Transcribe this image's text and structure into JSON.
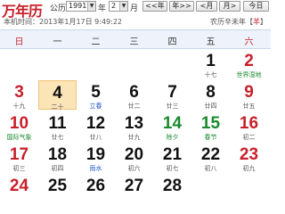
{
  "toolbar": {
    "title": "万年历",
    "calendar_type_label": "公历",
    "year_value": "1991",
    "year_unit": "年",
    "month_value": "2",
    "month_unit": "月",
    "prev_year_label": "<<年",
    "next_year_label": "年>>",
    "prev_month_label": "<月",
    "next_month_label": "月>",
    "today_label": "今日"
  },
  "status": {
    "now_text": "本机时间：2013年1月17日  9:49:22",
    "lunar_year_prefix": "农历辛未年【",
    "lunar_zodiac": "羊",
    "lunar_year_suffix": "】"
  },
  "weekdays": [
    "日",
    "一",
    "二",
    "三",
    "四",
    "五",
    "六"
  ],
  "rows": [
    [
      {
        "day": "",
        "sub": ""
      },
      {
        "day": "",
        "sub": ""
      },
      {
        "day": "",
        "sub": ""
      },
      {
        "day": "",
        "sub": ""
      },
      {
        "day": "",
        "sub": ""
      },
      {
        "day": "1",
        "sub": "十七"
      },
      {
        "day": "2",
        "sub": "世界湿地",
        "sub_style": "green"
      }
    ],
    [
      {
        "day": "3",
        "sub": "十九"
      },
      {
        "day": "4",
        "sub": "二十",
        "today": true
      },
      {
        "day": "5",
        "sub": "立春",
        "sub_style": "blue"
      },
      {
        "day": "6",
        "sub": "廿二"
      },
      {
        "day": "7",
        "sub": "廿三"
      },
      {
        "day": "8",
        "sub": "廿四"
      },
      {
        "day": "9",
        "sub": "廿五"
      }
    ],
    [
      {
        "day": "10",
        "sub": "国际气象",
        "sub_style": "green"
      },
      {
        "day": "11",
        "sub": "廿七"
      },
      {
        "day": "12",
        "sub": "廿八"
      },
      {
        "day": "13",
        "sub": "廿九"
      },
      {
        "day": "14",
        "sub": "除夕",
        "num_style": "green",
        "sub_style": "green"
      },
      {
        "day": "15",
        "sub": "春节",
        "num_style": "green",
        "sub_style": "green"
      },
      {
        "day": "16",
        "sub": "初二"
      }
    ],
    [
      {
        "day": "17",
        "sub": "初三"
      },
      {
        "day": "18",
        "sub": "初四"
      },
      {
        "day": "19",
        "sub": "雨水",
        "sub_style": "blue"
      },
      {
        "day": "20",
        "sub": "初六"
      },
      {
        "day": "21",
        "sub": "初七"
      },
      {
        "day": "22",
        "sub": "初八"
      },
      {
        "day": "23",
        "sub": "初九"
      }
    ],
    [
      {
        "day": "24",
        "sub": ""
      },
      {
        "day": "25",
        "sub": ""
      },
      {
        "day": "26",
        "sub": ""
      },
      {
        "day": "27",
        "sub": ""
      },
      {
        "day": "28",
        "sub": ""
      },
      {
        "day": "",
        "sub": ""
      },
      {
        "day": "",
        "sub": ""
      }
    ]
  ],
  "colors": {
    "accent_red": "#c8202a",
    "festival_green": "#1a8a2e",
    "solar_term_blue": "#1f56c8",
    "today_bg": "#fbe4b6"
  }
}
